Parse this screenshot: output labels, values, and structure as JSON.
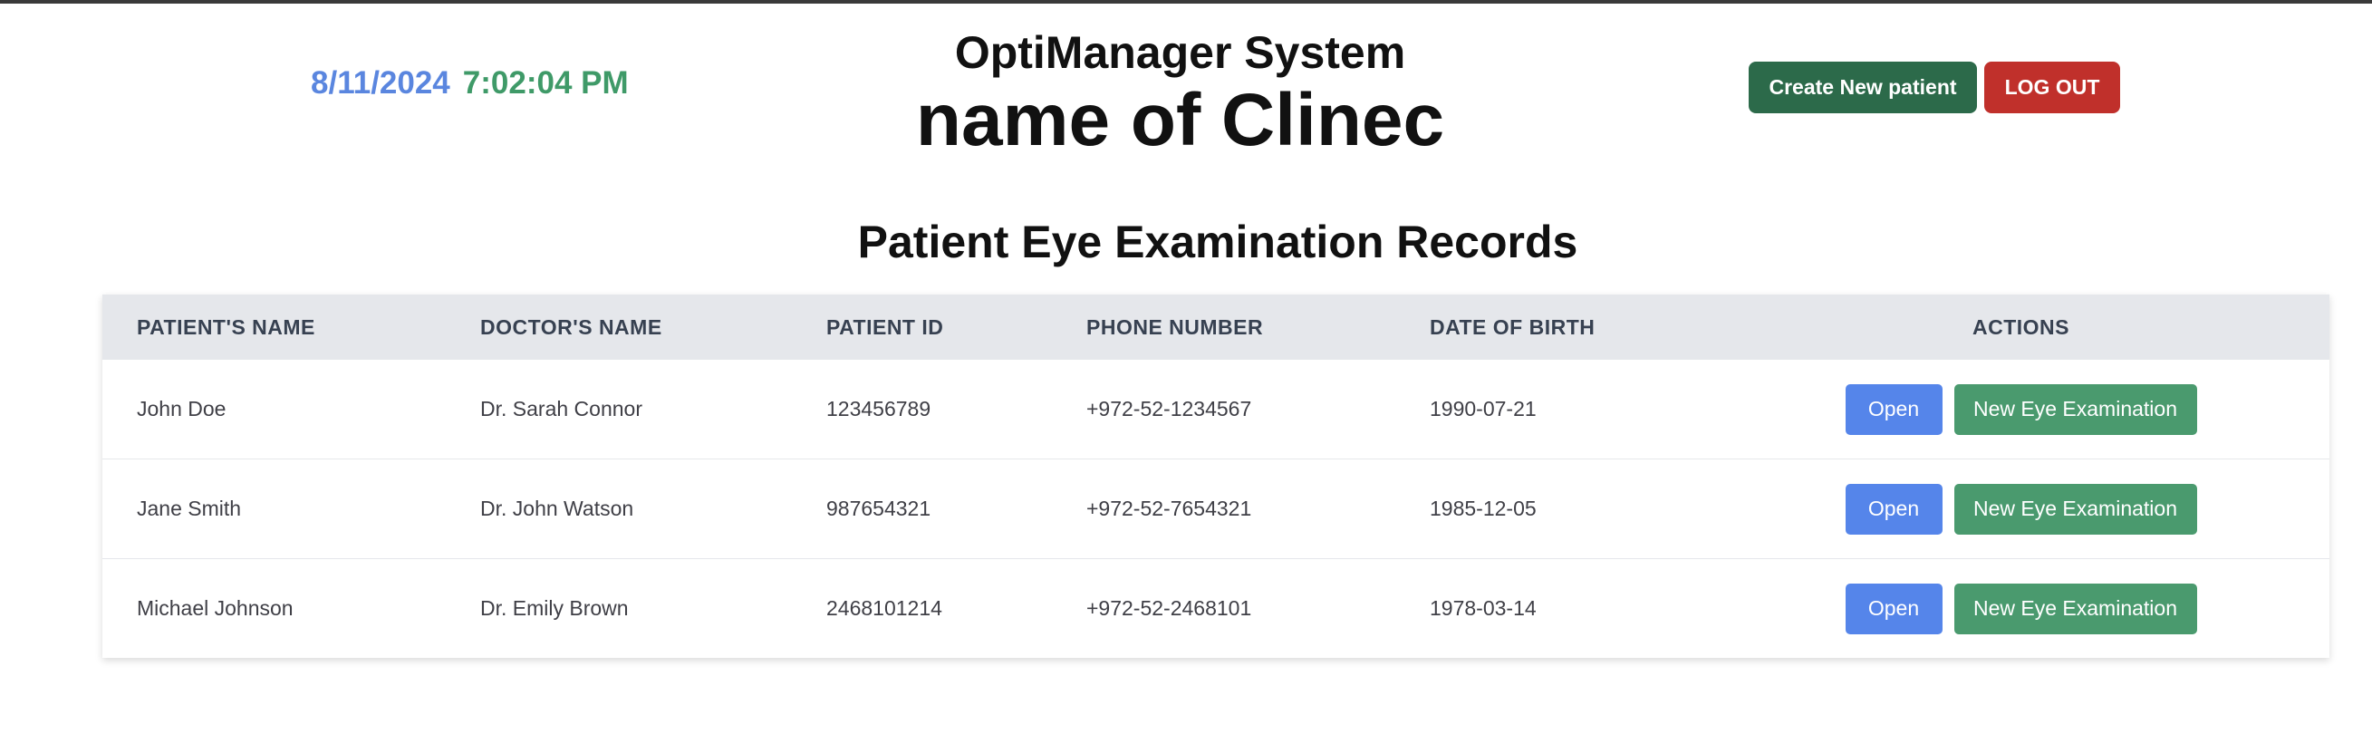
{
  "header": {
    "date": "8/11/2024",
    "time": "7:02:04 PM",
    "system_title": "OptiManager System",
    "clinic_name": "name of Clinec",
    "create_button": "Create New patient",
    "logout_button": "LOG OUT"
  },
  "records": {
    "title": "Patient Eye Examination Records",
    "columns": [
      "PATIENT'S NAME",
      "DOCTOR'S NAME",
      "PATIENT ID",
      "PHONE NUMBER",
      "DATE OF BIRTH",
      "ACTIONS"
    ],
    "rows": [
      {
        "patient": "John Doe",
        "doctor": "Dr. Sarah Connor",
        "id": "123456789",
        "phone": "+972-52-1234567",
        "dob": "1990-07-21"
      },
      {
        "patient": "Jane Smith",
        "doctor": "Dr. John Watson",
        "id": "987654321",
        "phone": "+972-52-7654321",
        "dob": "1985-12-05"
      },
      {
        "patient": "Michael Johnson",
        "doctor": "Dr. Emily Brown",
        "id": "2468101214",
        "phone": "+972-52-2468101",
        "dob": "1978-03-14"
      }
    ],
    "open_label": "Open",
    "exam_label": "New Eye Examination"
  },
  "colors": {
    "date": "#5a86df",
    "time": "#3f9a68",
    "create_button": "#2c6a4a",
    "logout_button": "#c0302b",
    "open_button": "#5585ea",
    "exam_button": "#4a9a6e"
  }
}
